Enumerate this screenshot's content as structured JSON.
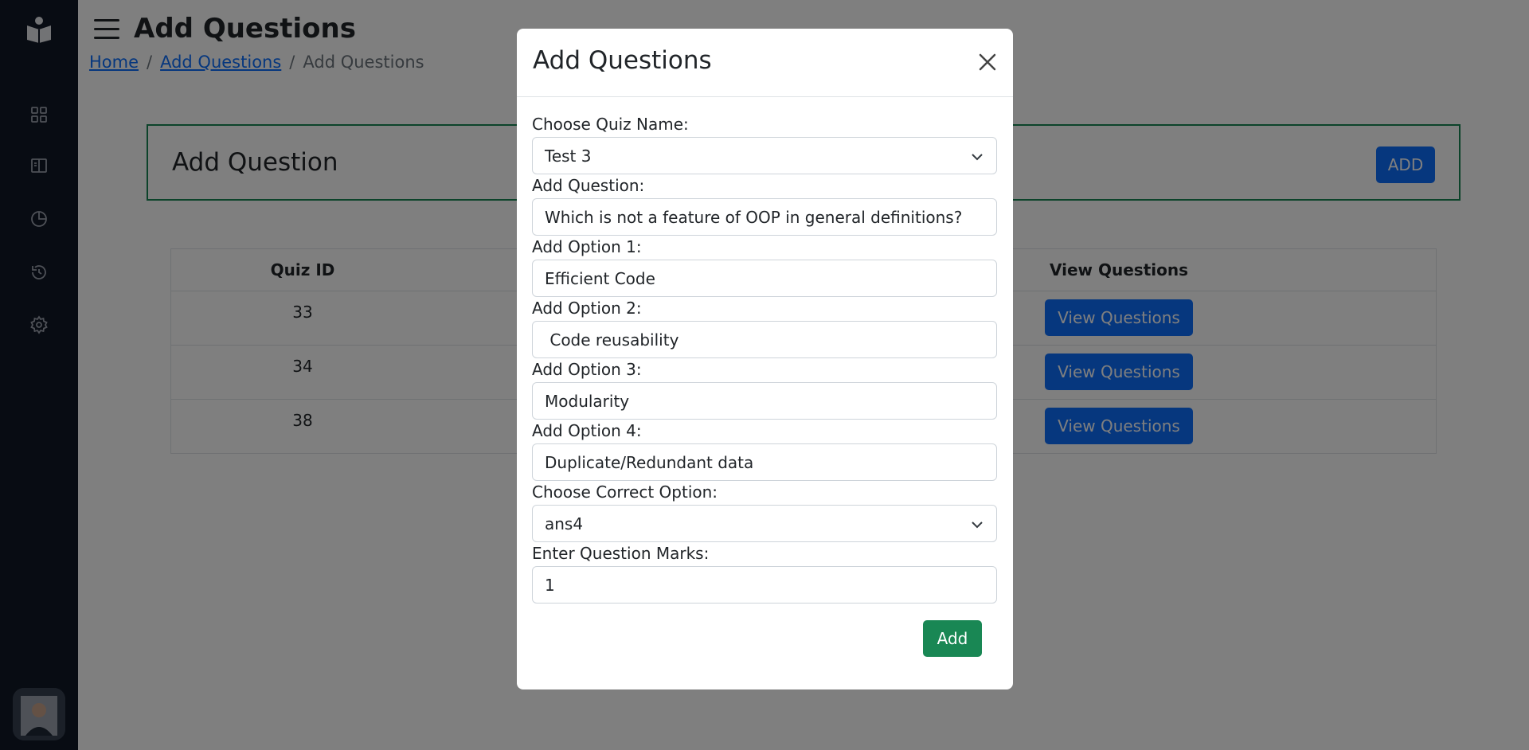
{
  "page": {
    "title": "Add Questions",
    "breadcrumb": [
      "Home",
      "Add Questions",
      "Add Questions"
    ]
  },
  "card": {
    "title": "Add Question",
    "button": "ADD"
  },
  "table": {
    "headers": {
      "quiz_id": "Quiz ID",
      "view": "View Questions"
    },
    "rows": [
      {
        "quiz_id": "33",
        "action": "View Questions"
      },
      {
        "quiz_id": "34",
        "action": "View Questions"
      },
      {
        "quiz_id": "38",
        "action": "View Questions"
      }
    ]
  },
  "modal": {
    "title": "Add Questions",
    "quiz_label": "Choose Quiz Name:",
    "quiz_value": "Test 3",
    "question_label": "Add Question:",
    "question_value": "Which is not a feature of OOP in general definitions?",
    "option1_label": "Add Option 1:",
    "option1_value": "Efficient Code",
    "option2_label": "Add Option 2:",
    "option2_value": " Code reusability",
    "option3_label": "Add Option 3:",
    "option3_value": "Modularity",
    "option4_label": "Add Option 4:",
    "option4_value": "Duplicate/Redundant data",
    "correct_label": "Choose Correct Option:",
    "correct_value": "ans4",
    "marks_label": "Enter Question Marks:",
    "marks_value": "1",
    "submit": "Add"
  },
  "icons": {
    "sidebar": [
      "book-logo-icon",
      "dashboard-icon",
      "book-icon",
      "chart-pie-icon",
      "history-icon",
      "settings-icon",
      "avatar"
    ],
    "close": "close-icon",
    "chevron": "chevron-down-icon"
  },
  "colors": {
    "primary": "#0d6efd",
    "success": "#198754",
    "sidebar": "#111827"
  }
}
